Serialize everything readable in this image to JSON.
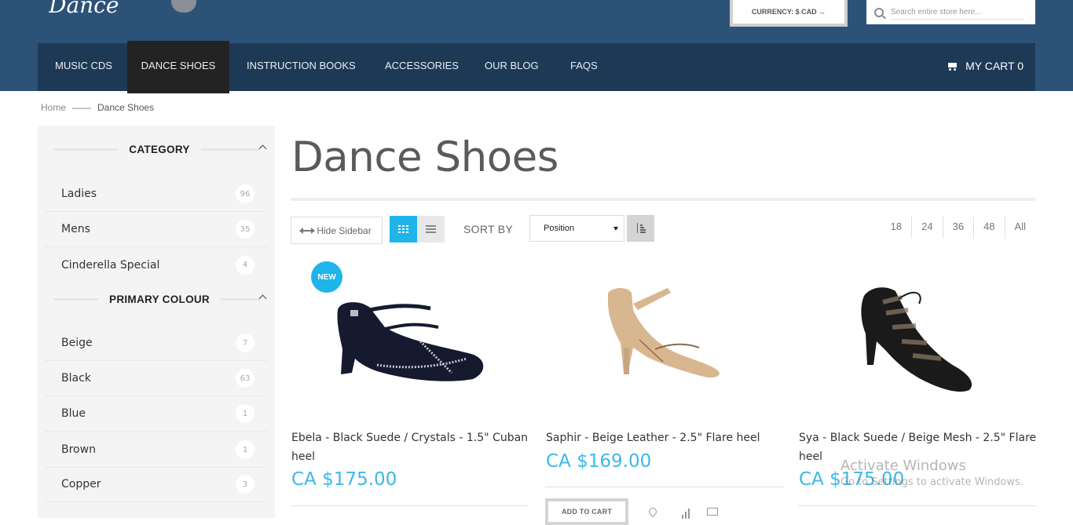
{
  "header": {
    "logo_text": "Dance",
    "currency_label": "CURRENCY: $ CAD ↔",
    "search_placeholder": "Search entire store here..."
  },
  "nav": {
    "items": [
      {
        "label": "MUSIC CDS"
      },
      {
        "label": "DANCE SHOES",
        "active": true
      },
      {
        "label": "INSTRUCTION BOOKS"
      },
      {
        "label": "ACCESSORIES"
      },
      {
        "label": "OUR BLOG"
      },
      {
        "label": "FAQS"
      }
    ],
    "cart_label": "MY CART 0"
  },
  "breadcrumb": {
    "home": "Home",
    "separator": "——",
    "current": "Dance Shoes"
  },
  "sidebar": {
    "category_title": "CATEGORY",
    "categories": [
      {
        "label": "Ladies",
        "count": "96"
      },
      {
        "label": "Mens",
        "count": "35"
      },
      {
        "label": "Cinderella Special",
        "count": "4"
      }
    ],
    "colour_title": "PRIMARY COLOUR",
    "colours": [
      {
        "label": "Beige",
        "count": "7"
      },
      {
        "label": "Black",
        "count": "63"
      },
      {
        "label": "Blue",
        "count": "1"
      },
      {
        "label": "Brown",
        "count": "1"
      },
      {
        "label": "Copper",
        "count": "3"
      }
    ]
  },
  "page_title": "Dance Shoes",
  "toolbar": {
    "hide_sidebar": "Hide Sidebar",
    "sort_by": "SORT BY",
    "sort_value": "Position",
    "limits": [
      "18",
      "24",
      "36",
      "48",
      "All"
    ]
  },
  "products": [
    {
      "badge": "NEW",
      "name": "Ebela - Black Suede / Crystals - 1.5\" Cuban heel",
      "price": "CA $175.00"
    },
    {
      "name": "Saphir - Beige Leather - 2.5\" Flare heel",
      "price": "CA $169.00",
      "add_to_cart": "ADD TO CART"
    },
    {
      "name": "Sya - Black Suede / Beige Mesh - 2.5\" Flare heel",
      "price": "CA $175.00"
    }
  ],
  "watermark": {
    "line1": "Activate Windows",
    "line2": "Go to Settings to activate Windows."
  },
  "colors": {
    "header_bg": "#2d5278",
    "nav_bg": "#1d3955",
    "nav_active_bg": "#232323",
    "accent": "#1fb5ea",
    "price": "#3db8e8"
  }
}
